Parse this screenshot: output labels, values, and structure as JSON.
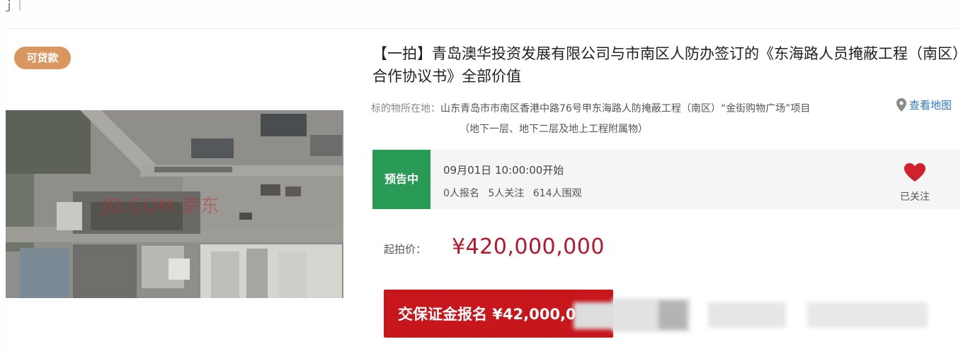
{
  "card": {
    "loan_badge": "可贷款",
    "watermark": "JD.COM 京东",
    "title": "【一拍】青岛澳华投资发展有限公司与市南区人防办签订的《东海路人员掩蔽工程（南区）合作协议书》全部价值",
    "address": {
      "label": "标的物所在地：",
      "line1": "山东青岛市市南区香港中路76号甲东海路人防掩蔽工程（南区）“金街购物广场”项目",
      "line2": "（地下一层、地下二层及地上工程附属物）",
      "map_link": "查看地图"
    },
    "status": {
      "badge": "预告中",
      "start_time": "09月01日 10:00:00开始",
      "signups": "0人报名",
      "followers": "5人关注",
      "viewers": "614人围观",
      "follow_label": "已关注"
    },
    "price": {
      "label": "起拍价：",
      "value": "¥420,000,000"
    },
    "register_button": "交保证金报名 ¥42,000,0"
  },
  "colors": {
    "loan_badge": "#d9965e",
    "status_badge": "#2a9a57",
    "price": "#b5172d",
    "button": "#c8161d",
    "map_link": "#2d78c8",
    "heart": "#d0212e"
  },
  "icons": {
    "map": "map-pin-icon",
    "follow": "heart-icon"
  }
}
